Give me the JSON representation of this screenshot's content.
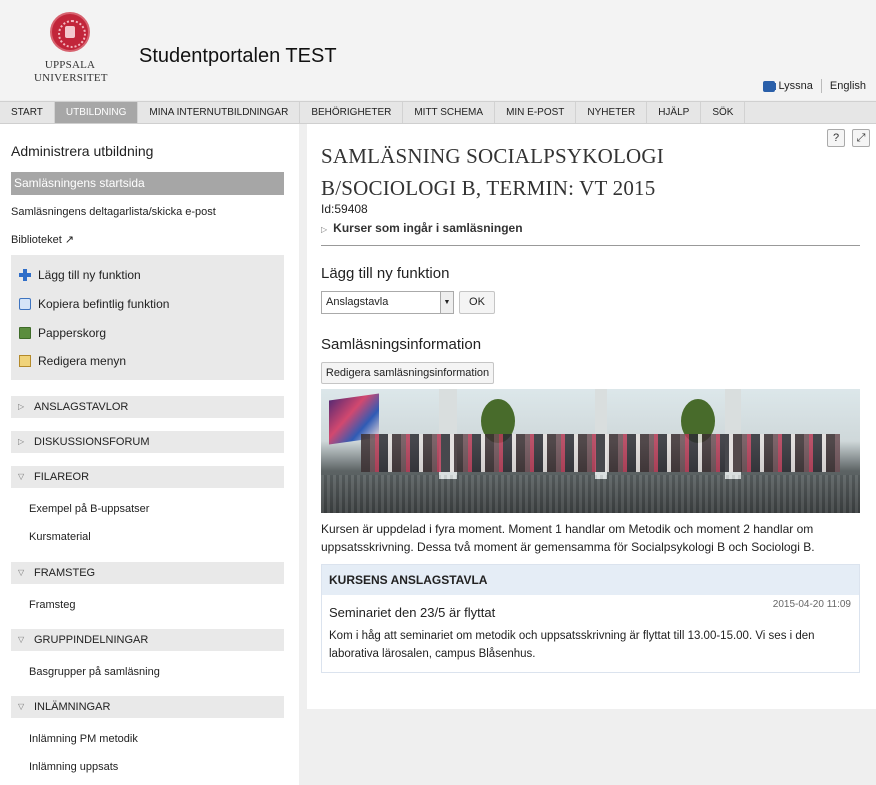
{
  "header": {
    "logo_line1": "UPPSALA",
    "logo_line2": "UNIVERSITET",
    "title": "Studentportalen TEST",
    "listen_label": "Lyssna",
    "language_label": "English"
  },
  "nav": {
    "items": [
      "START",
      "UTBILDNING",
      "MINA INTERNUTBILDNINGAR",
      "BEHÖRIGHETER",
      "MITT SCHEMA",
      "MIN E-POST",
      "NYHETER",
      "HJÄLP",
      "SÖK"
    ],
    "active": "UTBILDNING"
  },
  "sidebar": {
    "heading": "Administrera utbildning",
    "current": "Samläsningens startsida",
    "participants": "Samläsningens deltagarlista/skicka e-post",
    "library": "Biblioteket",
    "functions": [
      "Lägg till ny funktion",
      "Kopiera befintlig funktion",
      "Papperskorg",
      "Redigera menyn"
    ],
    "sections": {
      "boards": "ANSLAGSTAVLOR",
      "forums": "DISKUSSIONSFORUM",
      "files": "FILAREOR",
      "files_items": [
        "Exempel på B-uppsatser",
        "Kursmaterial"
      ],
      "progress": "FRAMSTEG",
      "progress_items": [
        "Framsteg"
      ],
      "groups": "GRUPPINDELNINGAR",
      "groups_items": [
        "Basgrupper på samläsning"
      ],
      "submissions": "INLÄMNINGAR",
      "submissions_items": [
        "Inlämning PM metodik",
        "Inlämning uppsats"
      ]
    }
  },
  "main": {
    "help_label": "?",
    "expand_label": "⤢",
    "title": "SAMLÄSNING SOCIALPSYKOLOGI B/SOCIOLOGI B, TERMIN: VT 2015",
    "id": "Id:59408",
    "courses_link": "Kurser som ingår i samläsningen",
    "add_function_heading": "Lägg till ny funktion",
    "select_value": "Anslagstavla",
    "ok_label": "OK",
    "info_heading": "Samläsningsinformation",
    "edit_info_label": "Redigera samläsningsinformation",
    "description": "Kursen är uppdelad i fyra moment. Moment 1 handlar om Metodik och moment 2 handlar om uppsatsskrivning. Dessa två moment är gemensamma för Socialpsykologi B och Sociologi B.",
    "board": {
      "heading": "KURSENS ANSLAGSTAVLA",
      "post_title": "Seminariet den 23/5 är flyttat",
      "post_date": "2015-04-20 11:09",
      "post_body": "Kom i håg att seminariet om metodik och uppsatsskrivning är flyttat till 13.00-15.00. Vi ses i den laborativa lärosalen, campus Blåsenhus."
    }
  }
}
